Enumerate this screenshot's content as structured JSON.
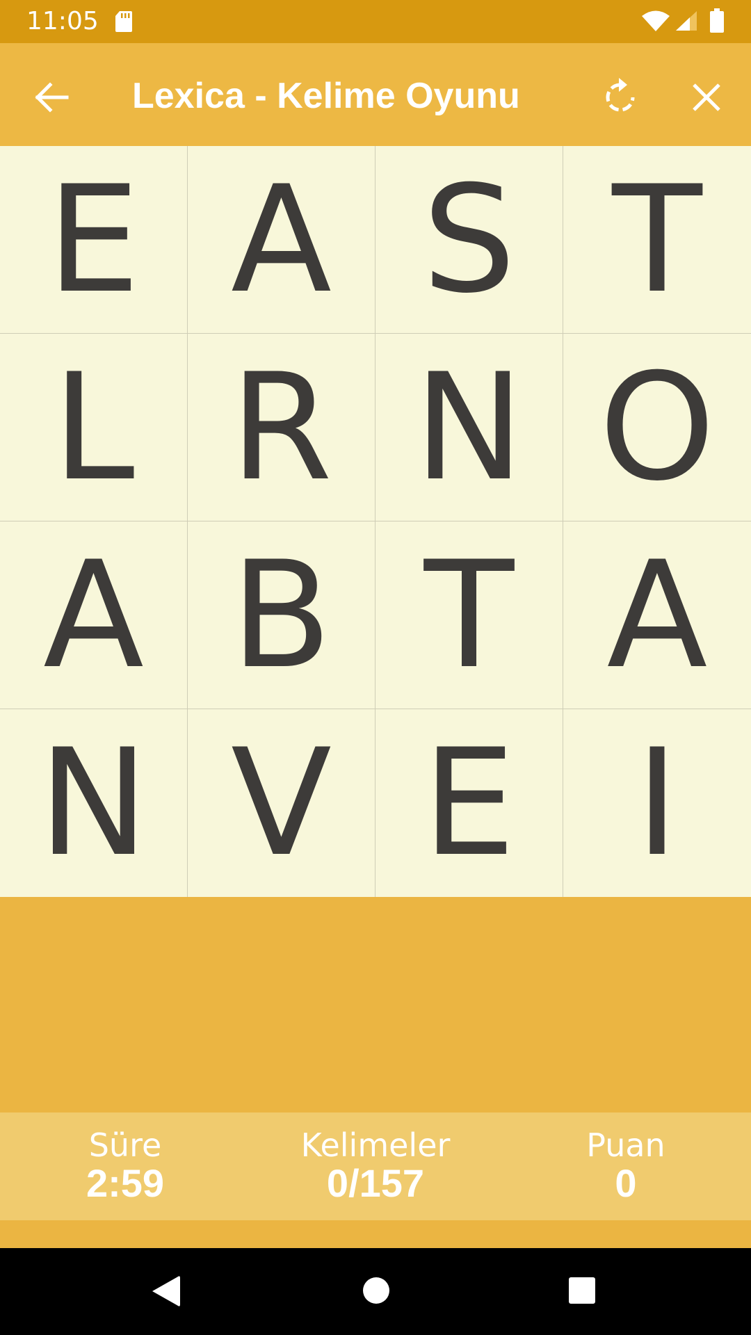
{
  "status_bar": {
    "time": "11:05",
    "icons": [
      "sd-card-icon",
      "wifi-icon",
      "signal-icon",
      "battery-icon"
    ]
  },
  "app_bar": {
    "title": "Lexica - Kelime Oyunu",
    "icons": [
      "back-arrow-icon",
      "restart-icon",
      "close-icon"
    ]
  },
  "board": {
    "rows": [
      [
        "E",
        "A",
        "S",
        "T"
      ],
      [
        "L",
        "R",
        "N",
        "O"
      ],
      [
        "A",
        "B",
        "T",
        "A"
      ],
      [
        "N",
        "V",
        "E",
        "I"
      ]
    ]
  },
  "stats": {
    "time_label": "Süre",
    "time_value": "2:59",
    "words_label": "Kelimeler",
    "words_value": "0/157",
    "score_label": "Puan",
    "score_value": "0"
  },
  "colors": {
    "status_bar": "#d79910",
    "app_bar": "#edb844",
    "background": "#ebb542",
    "tile": "#f8f7da",
    "tile_text": "#3d3b39",
    "score_bar": "#f0cb6e"
  },
  "nav_bar": {
    "icons": [
      "nav-back-icon",
      "nav-home-icon",
      "nav-recents-icon"
    ]
  }
}
